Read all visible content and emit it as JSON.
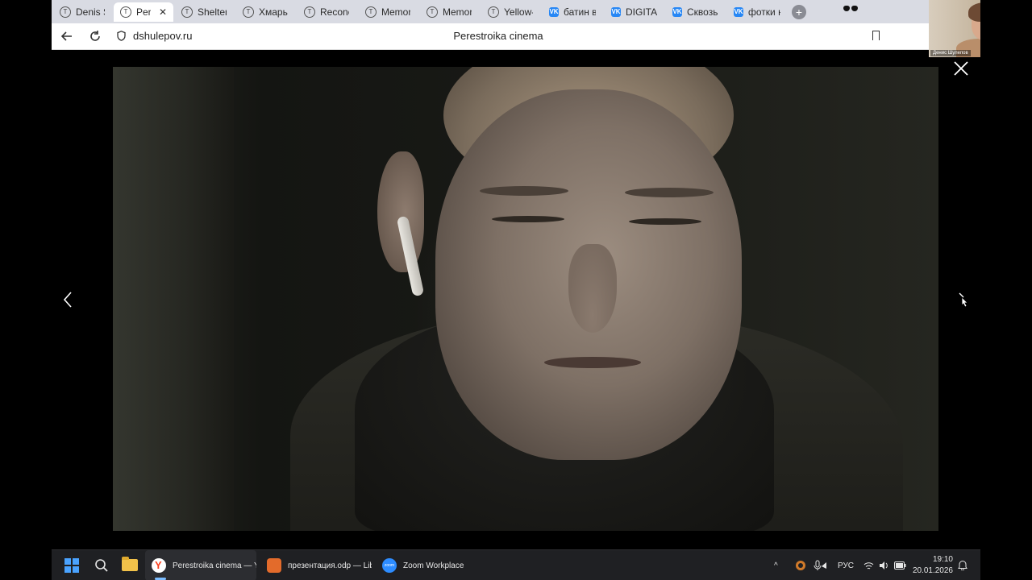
{
  "browser": {
    "tabs": [
      {
        "label": "Denis Sh",
        "icon": "tilda-icon",
        "active": false
      },
      {
        "label": "Peres",
        "icon": "tilda-icon",
        "active": true
      },
      {
        "label": "Shelter",
        "icon": "tilda-icon",
        "active": false
      },
      {
        "label": "Хмарь-",
        "icon": "tilda-icon",
        "active": false
      },
      {
        "label": "Reconci",
        "icon": "tilda-icon",
        "active": false
      },
      {
        "label": "Memora",
        "icon": "tilda-icon",
        "active": false
      },
      {
        "label": "Memora",
        "icon": "tilda-icon",
        "active": false
      },
      {
        "label": "Yellow-c",
        "icon": "tilda-icon",
        "active": false
      },
      {
        "label": "батин в",
        "icon": "vk-icon",
        "active": false
      },
      {
        "label": "DIGITAL",
        "icon": "vk-icon",
        "active": false
      },
      {
        "label": "Сквозь",
        "icon": "vk-icon",
        "active": false
      },
      {
        "label": "фотки н",
        "icon": "vk-icon",
        "active": false
      }
    ],
    "tab_close_glyph": "✕",
    "new_tab_glyph": "+",
    "url": "dshulepov.ru",
    "page_title": "Perestroika cinema"
  },
  "webcam": {
    "name": "Денис Шулепов"
  },
  "viewer": {
    "close_glyph": "✕",
    "prev_glyph": "‹",
    "next_glyph": "›"
  },
  "taskbar": {
    "apps": [
      {
        "label": "Perestroika cinema — Ya",
        "icon": "yandex-browser-icon"
      },
      {
        "label": "презентация.odp — Lib",
        "icon": "libreoffice-impress-icon"
      },
      {
        "label": "Zoom Workplace",
        "icon": "zoom-icon"
      }
    ],
    "zoom_icon_text": "zoom",
    "tray": {
      "overflow_glyph": "^",
      "language": "РУС",
      "time": "19:10",
      "date": "20.01.2026"
    }
  },
  "colors": {
    "tab_strip": "#d9dbe3",
    "taskbar": "#1f2023",
    "accent": "#4aa3ff",
    "vk": "#2787f5"
  }
}
